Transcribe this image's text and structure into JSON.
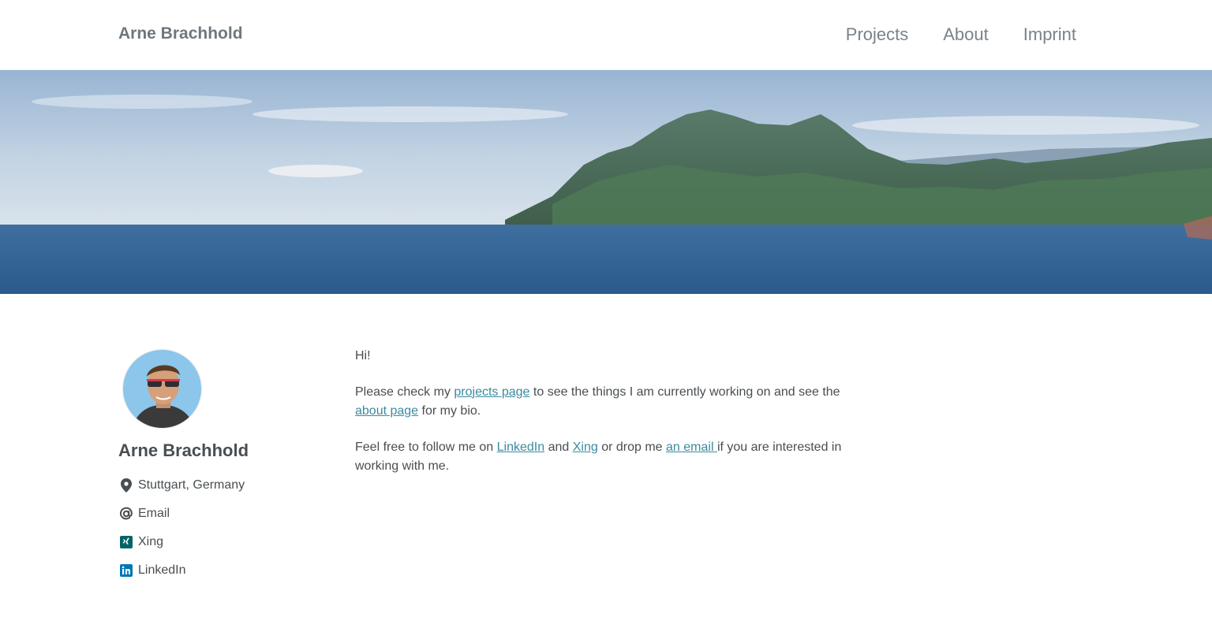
{
  "header": {
    "site_title": "Arne Brachhold",
    "nav": [
      "Projects",
      "About",
      "Imprint"
    ]
  },
  "sidebar": {
    "name": "Arne Brachhold",
    "location": "Stuttgart, Germany",
    "links": {
      "email": "Email",
      "xing": "Xing",
      "linkedin": "LinkedIn"
    }
  },
  "content": {
    "greeting": "Hi!",
    "p1": {
      "before": "Please check my ",
      "link1": "projects page",
      "middle": " to see the things I am currently working on and see the ",
      "link2": "about page",
      "after": " for my bio."
    },
    "p2": {
      "before": "Feel free to follow me on ",
      "link_linkedin": "LinkedIn",
      "and": " and ",
      "link_xing": "Xing",
      "drop": " or drop me ",
      "link_email": "an email ",
      "after": "if you are interested in working with me."
    }
  },
  "colors": {
    "link": "#3b8aa1",
    "xing": "#026466",
    "linkedin": "#0077b5",
    "text": "#494e52"
  },
  "icons": [
    "location-icon",
    "at-icon",
    "xing-icon",
    "linkedin-icon"
  ]
}
